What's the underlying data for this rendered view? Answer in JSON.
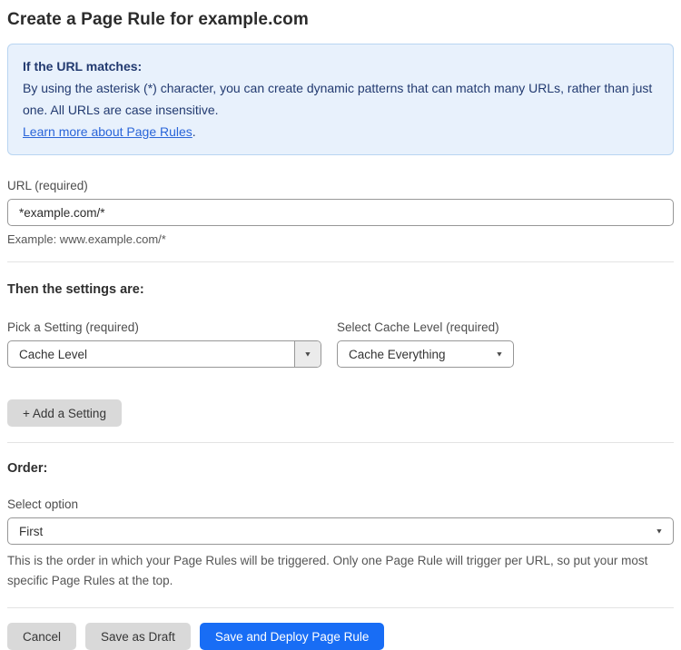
{
  "page": {
    "title": "Create a Page Rule for example.com"
  },
  "info_box": {
    "heading": "If the URL matches:",
    "body": "By using the asterisk (*) character, you can create dynamic patterns that can match many URLs, rather than just one. All URLs are case insensitive.",
    "link_label": "Learn more about Page Rules",
    "link_suffix": "."
  },
  "url_field": {
    "label": "URL (required)",
    "value": "*example.com/*",
    "helper": "Example: www.example.com/*"
  },
  "settings_section": {
    "heading": "Then the settings are:",
    "setting_picker": {
      "label": "Pick a Setting (required)",
      "value": "Cache Level"
    },
    "cache_level_picker": {
      "label": "Select Cache Level (required)",
      "value": "Cache Everything"
    },
    "add_setting_label": "+ Add a Setting"
  },
  "order_section": {
    "heading": "Order:",
    "select_label": "Select option",
    "value": "First",
    "helper": "This is the order in which your Page Rules will be triggered. Only one Page Rule will trigger per URL, so put your most specific Page Rules at the top."
  },
  "footer": {
    "cancel_label": "Cancel",
    "save_draft_label": "Save as Draft",
    "save_deploy_label": "Save and Deploy Page Rule"
  },
  "icons": {
    "dropdown_caret": "▼"
  },
  "colors": {
    "accent_blue": "#186df5",
    "info_background": "#e8f1fc",
    "info_border": "#b9d5f1",
    "info_text": "#223a70",
    "link_blue": "#2a65d9",
    "button_gray": "#d9d9d9"
  }
}
